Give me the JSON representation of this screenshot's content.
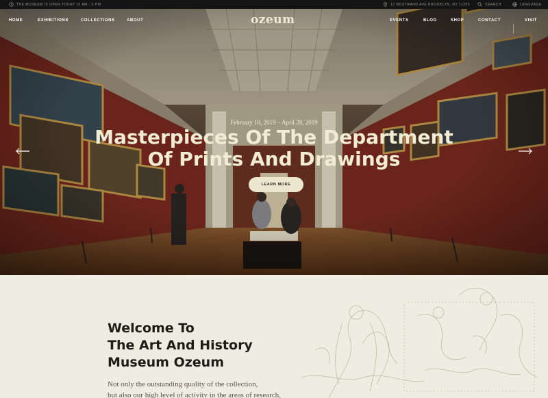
{
  "topbar": {
    "hours": "The museum is open today 10 AM - 5 PM",
    "address": "12 Nostrand Ave Brooklyn, NY 11205",
    "search": "Search",
    "language": "Language"
  },
  "nav": {
    "logo": "ozeum",
    "left": [
      "Home",
      "Exhibitions",
      "Collections",
      "About"
    ],
    "right": [
      "Events",
      "Blog",
      "Shop",
      "Contact"
    ],
    "visit": "Visit"
  },
  "hero": {
    "date": "February 10, 2019 – April 28, 2019",
    "title_line1": "Masterpieces Of The Department",
    "title_line2": "Of Prints And Drawings",
    "button": "Learn More"
  },
  "welcome": {
    "heading_line1": "Welcome To",
    "heading_line2": "The Art And History",
    "heading_line3": "Museum Ozeum",
    "text_line1": "Not only the outstanding quality of the collection,",
    "text_line2": "but also our high level of activity in the areas of research,"
  },
  "colors": {
    "accent_cream": "#ece6cf",
    "topbar_bg": "#141414",
    "section_bg": "#efece1",
    "gallery_wall": "#7a2a1f"
  }
}
